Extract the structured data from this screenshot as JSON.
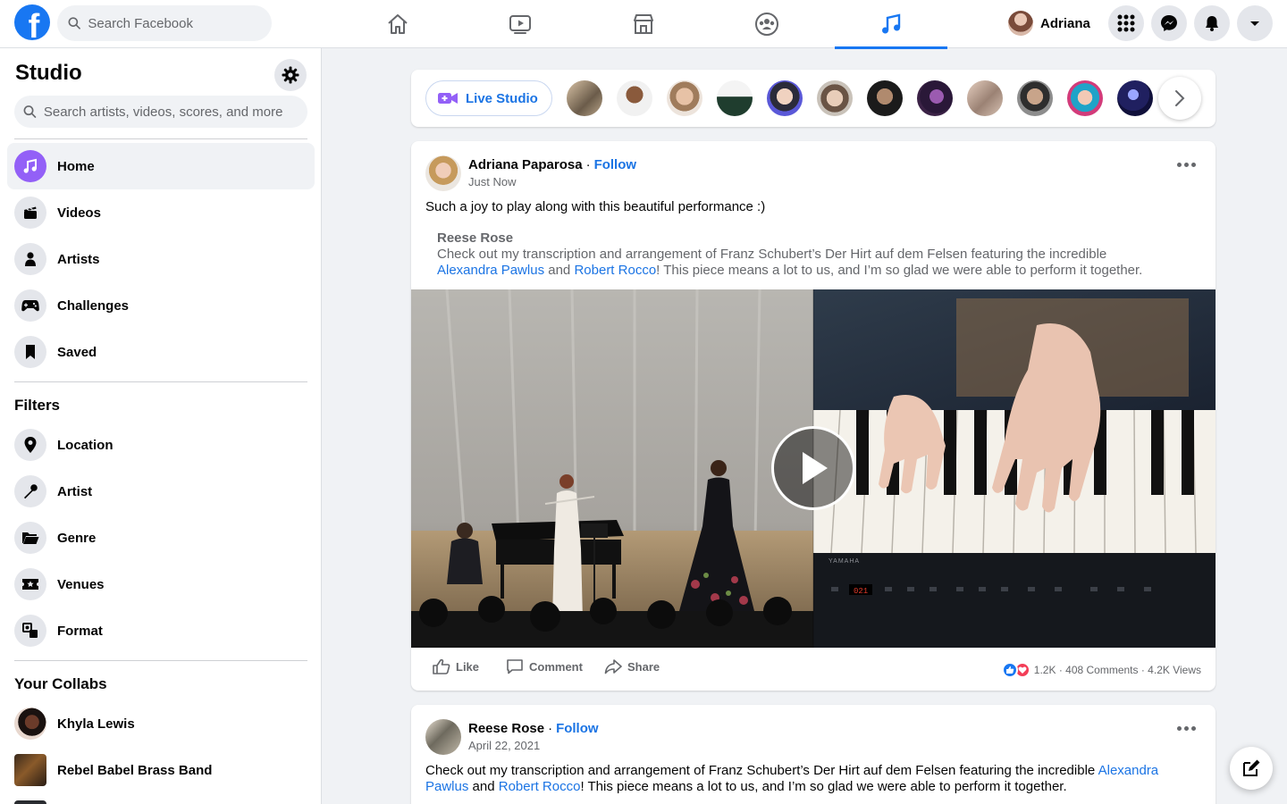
{
  "topbar": {
    "logo_letter": "f",
    "search_placeholder": "Search Facebook",
    "profile_name": "Adriana",
    "nav_tabs": [
      "home",
      "watch",
      "marketplace",
      "groups",
      "studio"
    ]
  },
  "sidebar": {
    "title": "Studio",
    "search_placeholder": "Search artists, videos, scores, and more",
    "items": [
      {
        "label": "Home",
        "icon": "music-note-icon",
        "active": true
      },
      {
        "label": "Videos",
        "icon": "clapperboard-icon"
      },
      {
        "label": "Artists",
        "icon": "person-icon"
      },
      {
        "label": "Challenges",
        "icon": "gamepad-icon"
      },
      {
        "label": "Saved",
        "icon": "bookmark-icon"
      }
    ],
    "filters_title": "Filters",
    "filters": [
      {
        "label": "Location",
        "icon": "location-pin-icon"
      },
      {
        "label": "Artist",
        "icon": "microphone-icon"
      },
      {
        "label": "Genre",
        "icon": "folder-icon"
      },
      {
        "label": "Venues",
        "icon": "ticket-icon"
      },
      {
        "label": "Format",
        "icon": "format-icon"
      }
    ],
    "collabs_title": "Your Collabs",
    "collabs": [
      {
        "label": "Khyla Lewis"
      },
      {
        "label": "Rebel Babel Brass Band"
      }
    ]
  },
  "stories": {
    "live_label": "Live Studio"
  },
  "post1": {
    "author": "Adriana Paparosa",
    "separator": "·",
    "follow": "Follow",
    "time": "Just Now",
    "text": "Such a joy to play along with this beautiful performance :)",
    "shared_author": "Reese Rose",
    "shared_text_1": "Check out my transcription and arrangement of Franz Schubert’s Der Hirt auf dem Felsen featuring the incredible",
    "shared_link_1": "Alexandra Pawlus",
    "shared_and": "and",
    "shared_link_2": "Robert Rocco",
    "shared_text_2": "! This piece means a lot to us, and I’m so glad we were able to perform it together.",
    "like": "Like",
    "comment": "Comment",
    "share": "Share",
    "stats": "1.2K · 408 Comments · 4.2K Views"
  },
  "post2": {
    "author": "Reese Rose",
    "separator": "·",
    "follow": "Follow",
    "time": "April 22, 2021",
    "text_1": "Check out my transcription and arrangement of Franz Schubert’s Der Hirt auf dem Felsen featuring the incredible",
    "link_1": "Alexandra Pawlus",
    "and": "and",
    "link_2": "Robert Rocco",
    "text_2": "! This piece means a lot to us, and I’m so glad we were able to perform it together."
  },
  "colors": {
    "accent": "#1877f2",
    "studio_purple": "#9360f7",
    "link": "#1b74e4"
  }
}
